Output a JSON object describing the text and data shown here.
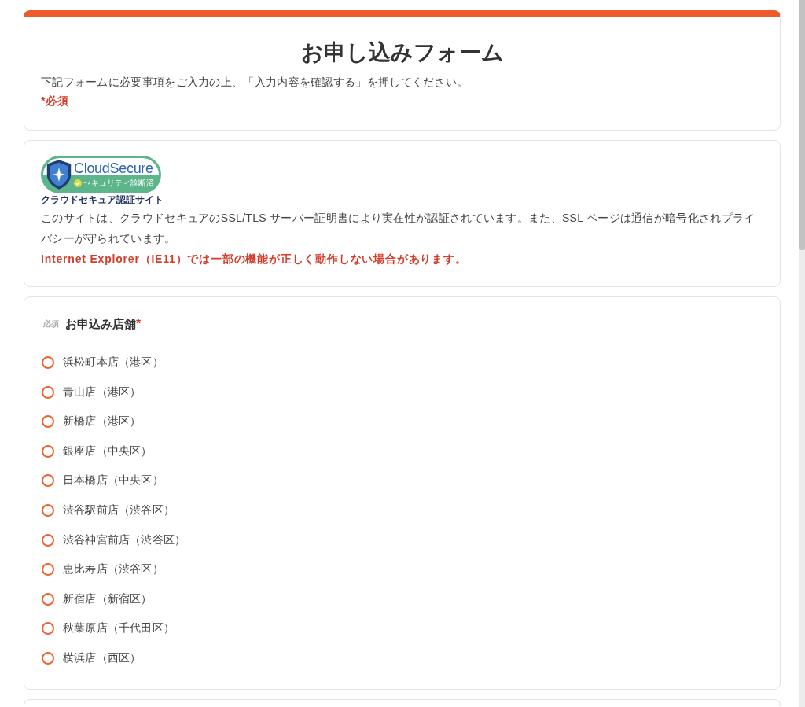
{
  "header": {
    "title": "お申し込みフォーム",
    "instructions": "下記フォームに必要事項をご入力の上、「入力内容を確認する」を押してください。",
    "required_note": "*必須"
  },
  "security": {
    "badge": {
      "brand": "CloudSecure",
      "status": "セキュリティ診断済",
      "caption": "クラウドセキュア認証サイト"
    },
    "description": "このサイトは、クラウドセキュアのSSL/TLS サーバー証明書により実在性が認証されています。また、SSL ページは通信が暗号化されプライバシーが守られています。",
    "warning": "Internet Explorer（IE11）では一部の機能が正しく動作しない場合があります。"
  },
  "store_field": {
    "tag": "必須",
    "label": "お申込み店舗",
    "required_mark": "*",
    "options": [
      {
        "label": "浜松町本店（港区）",
        "selected": false
      },
      {
        "label": "青山店（港区）",
        "selected": false
      },
      {
        "label": "新橋店（港区）",
        "selected": false
      },
      {
        "label": "銀座店（中央区）",
        "selected": false
      },
      {
        "label": "日本橋店（中央区）",
        "selected": false
      },
      {
        "label": "渋谷駅前店（渋谷区）",
        "selected": false
      },
      {
        "label": "渋谷神宮前店（渋谷区）",
        "selected": false
      },
      {
        "label": "恵比寿店（渋谷区）",
        "selected": false
      },
      {
        "label": "新宿店（新宿区）",
        "selected": false
      },
      {
        "label": "秋葉原店（千代田区）",
        "selected": false
      },
      {
        "label": "横浜店（西区）",
        "selected": false
      }
    ]
  }
}
